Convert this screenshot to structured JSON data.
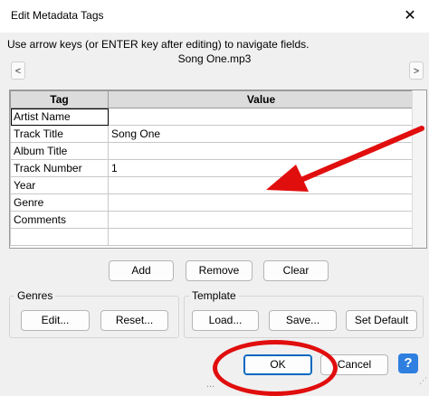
{
  "window": {
    "title": "Edit Metadata Tags",
    "close_glyph": "✕"
  },
  "hint": "Use arrow keys (or ENTER key after editing) to navigate fields.",
  "file_name": "Song One.mp3",
  "nav": {
    "prev": "<",
    "next": ">"
  },
  "table": {
    "columns": [
      "Tag",
      "Value"
    ],
    "rows": [
      {
        "tag": "Artist Name",
        "value": ""
      },
      {
        "tag": "Track Title",
        "value": "Song One"
      },
      {
        "tag": "Album Title",
        "value": ""
      },
      {
        "tag": "Track Number",
        "value": "1"
      },
      {
        "tag": "Year",
        "value": ""
      },
      {
        "tag": "Genre",
        "value": ""
      },
      {
        "tag": "Comments",
        "value": ""
      },
      {
        "tag": "",
        "value": ""
      }
    ]
  },
  "buttons": {
    "add": "Add",
    "remove": "Remove",
    "clear": "Clear"
  },
  "genres": {
    "label": "Genres",
    "edit": "Edit...",
    "reset": "Reset..."
  },
  "template": {
    "label": "Template",
    "load": "Load...",
    "save": "Save...",
    "set_default": "Set Default"
  },
  "footer": {
    "ok": "OK",
    "cancel": "Cancel",
    "help": "?",
    "partial_text": "..."
  },
  "annotations": {
    "color": "#e10e0e",
    "arrow": "red-arrow",
    "circle": "red-circle-around-ok"
  },
  "colors": {
    "accent": "#0067c0",
    "help": "#2f7fe0"
  }
}
